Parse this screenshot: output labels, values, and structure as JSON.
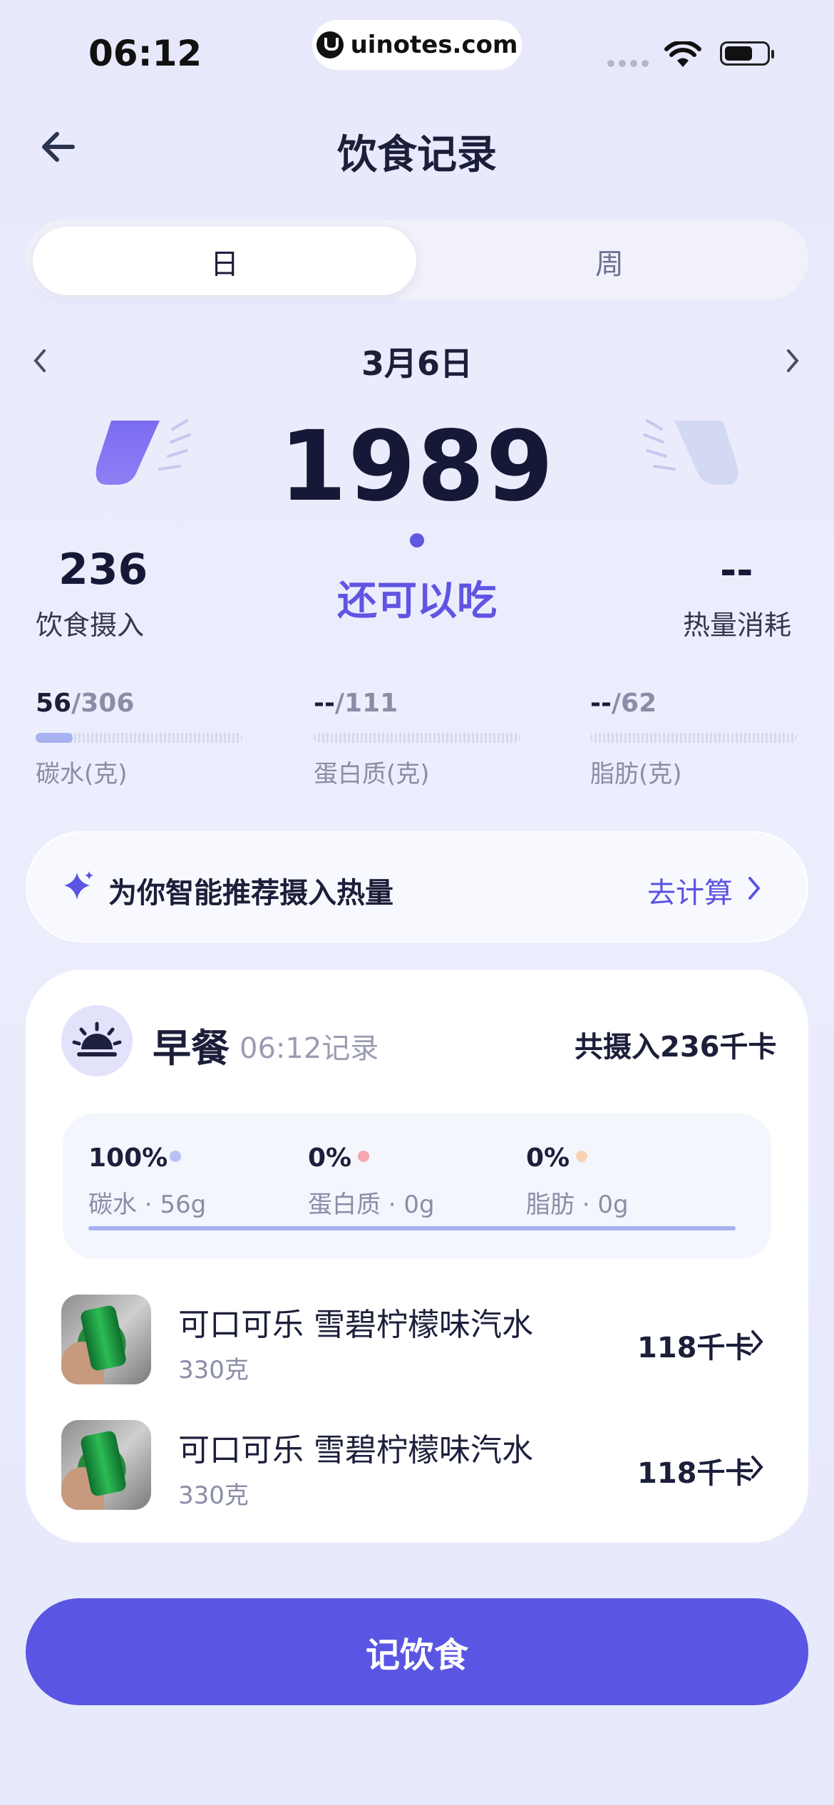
{
  "status_bar": {
    "time": "06:12",
    "url": "uinotes.com"
  },
  "header": {
    "title": "饮食记录"
  },
  "segment": {
    "day": "日",
    "week": "周",
    "selected": "日"
  },
  "date": {
    "label": "3月6日"
  },
  "calories": {
    "remaining": "1989",
    "remaining_label": "还可以吃",
    "intake": "236",
    "intake_label": "饮食摄入",
    "burned": "--",
    "burned_label": "热量消耗"
  },
  "macros": [
    {
      "current": "56",
      "target": "/306",
      "label": "碳水(克)",
      "progress": 0.18
    },
    {
      "current": "--",
      "target": "/111",
      "label": "蛋白质(克)",
      "progress": 0
    },
    {
      "current": "--",
      "target": "/62",
      "label": "脂肪(克)",
      "progress": 0
    }
  ],
  "recommend": {
    "text": "为你智能推荐摄入热量",
    "link": "去计算"
  },
  "meal": {
    "title": "早餐",
    "time": "06:12记录",
    "total": "共摄入236千卡",
    "breakdown": [
      {
        "pct": "100%",
        "sub": "碳水 · 56g",
        "color": "#b9c1f4"
      },
      {
        "pct": "0%",
        "sub": "蛋白质 · 0g",
        "color": "#f5a6ae"
      },
      {
        "pct": "0%",
        "sub": "脂肪 · 0g",
        "color": "#f6d3b1"
      }
    ],
    "items": [
      {
        "name": "可口可乐 雪碧柠檬味汽水",
        "weight": "330克",
        "kcal": "118千卡"
      },
      {
        "name": "可口可乐 雪碧柠檬味汽水",
        "weight": "330克",
        "kcal": "118千卡"
      }
    ]
  },
  "actions": {
    "record": "记饮食"
  },
  "colors": {
    "accent": "#5a55e2",
    "accent_text": "#6055e3"
  }
}
